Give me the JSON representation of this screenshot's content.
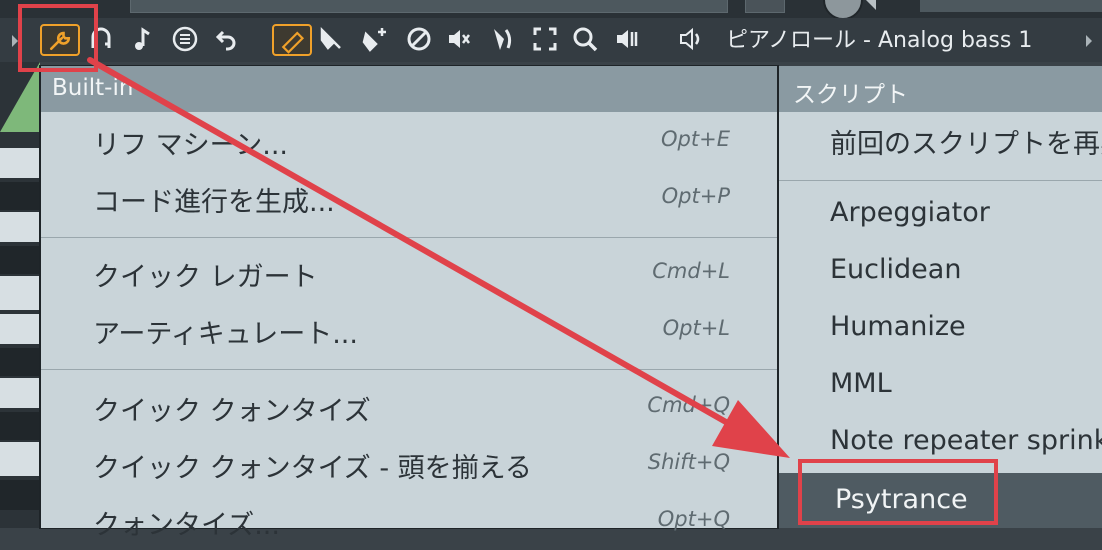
{
  "toolbar": {
    "piano_roll_title": "ピアノロール - Analog bass 1",
    "icons": [
      "wrench-icon",
      "magnet-icon",
      "note-icon",
      "menu-circle-icon",
      "undo-icon",
      "pencil-icon",
      "paint-icon",
      "brush-icon",
      "mute-tool-icon",
      "speaker-mute-icon",
      "slice-icon",
      "select-icon",
      "zoom-icon",
      "playback-icon",
      "speaker-icon"
    ]
  },
  "builtin_menu": {
    "header": "Built-in",
    "items": [
      {
        "label": "リフ マシーン...",
        "shortcut": "Opt+E"
      },
      {
        "label": "コード進行を生成...",
        "shortcut": "Opt+P"
      },
      {
        "label": "クイック レガート",
        "shortcut": "Cmd+L"
      },
      {
        "label": "アーティキュレート...",
        "shortcut": "Opt+L"
      },
      {
        "label": "クイック クォンタイズ",
        "shortcut": "Cmd+Q"
      },
      {
        "label": "クイック クォンタイズ - 頭を揃える",
        "shortcut": "Shift+Q"
      },
      {
        "label": "クォンタイズ...",
        "shortcut": "Opt+Q"
      }
    ]
  },
  "scripts_menu": {
    "header": "スクリプト",
    "items": [
      {
        "label": "前回のスクリプトを再実行"
      },
      {
        "label": "Arpeggiator"
      },
      {
        "label": "Euclidean"
      },
      {
        "label": "Humanize"
      },
      {
        "label": "MML"
      },
      {
        "label": "Note repeater sprinkle"
      },
      {
        "label": "Psytrance"
      }
    ]
  },
  "colors": {
    "accent_orange": "#f0a12a",
    "highlight_red": "#e0424a",
    "menu_bg": "#c9d4d9",
    "selected_bg": "#4f5b62"
  }
}
